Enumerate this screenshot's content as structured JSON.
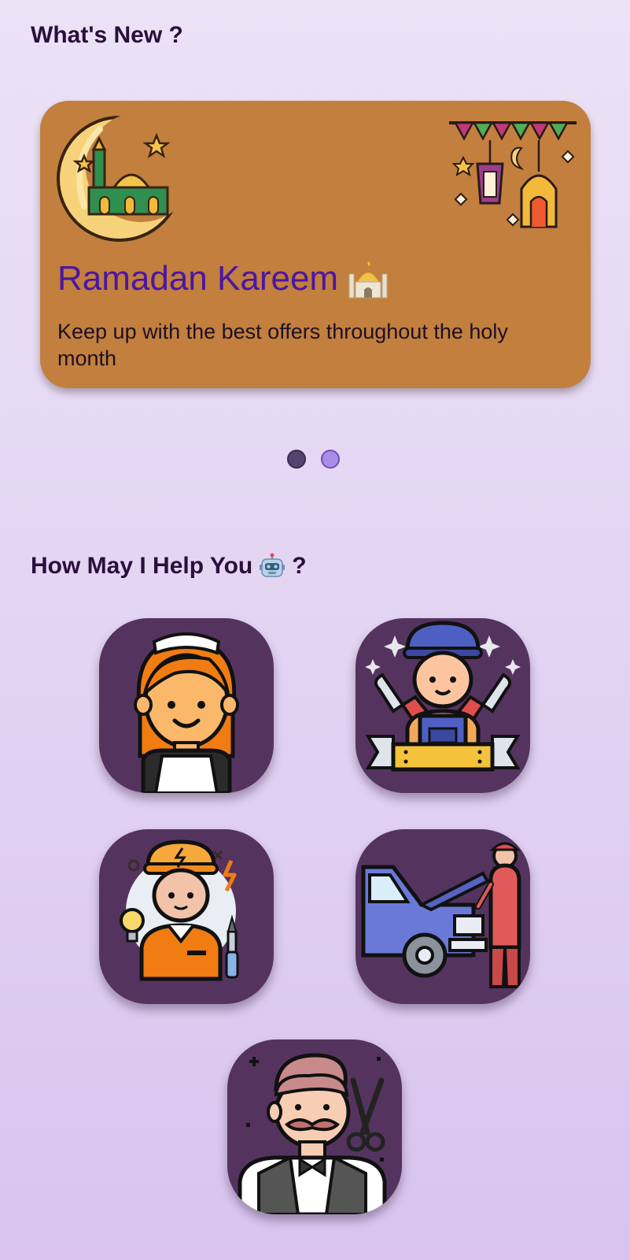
{
  "whats_new": {
    "title": "What's New ?"
  },
  "promo": {
    "title": "Ramadan Kareem",
    "title_emoji": "mosque",
    "description": "Keep up with the best offers throughout the holy month",
    "background_color": "#c27f3d",
    "title_color": "#4b16a4"
  },
  "carousel": {
    "total": 2,
    "active_index": 0
  },
  "help": {
    "title_text": "How May I Help You",
    "title_emoji": "robot",
    "title_suffix": "?"
  },
  "services": [
    {
      "name": "maid",
      "icon": "maid-icon"
    },
    {
      "name": "plumber",
      "icon": "plumber-icon"
    },
    {
      "name": "electrician",
      "icon": "electrician-icon"
    },
    {
      "name": "mechanic",
      "icon": "mechanic-icon"
    },
    {
      "name": "barber",
      "icon": "barber-icon"
    }
  ],
  "colors": {
    "tile_background": "#54345f",
    "heading": "#2a0f3c",
    "page_background_top": "#ece2f6",
    "page_background_bottom": "#d8c4ef"
  }
}
